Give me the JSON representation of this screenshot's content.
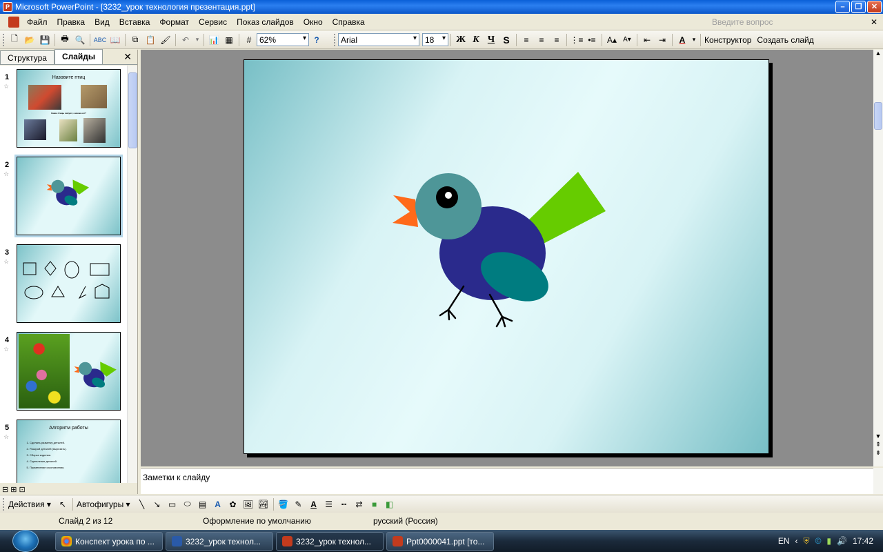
{
  "window": {
    "title": "Microsoft PowerPoint - [3232_урок технология презентация.ppt]"
  },
  "menu": {
    "items": [
      "Файл",
      "Правка",
      "Вид",
      "Вставка",
      "Формат",
      "Сервис",
      "Показ слайдов",
      "Окно",
      "Справка"
    ],
    "help_placeholder": "Введите вопрос"
  },
  "toolbar": {
    "zoom": "62%",
    "font": "Arial",
    "font_size": "18",
    "bold": "Ж",
    "italic": "К",
    "underline": "Ч",
    "shadow": "S",
    "designer": "Конструктор",
    "new_slide": "Создать слайд"
  },
  "left_pane": {
    "tabs": [
      "Структура",
      "Слайды"
    ],
    "slides": [
      {
        "num": "1",
        "title": "Назовите птиц",
        "caption": "Какие птицы зимуют, а какие нет?"
      },
      {
        "num": "2"
      },
      {
        "num": "3"
      },
      {
        "num": "4"
      },
      {
        "num": "5",
        "title": "Алгоритм работы",
        "steps": [
          "Сделать разметку деталей.",
          "Раскрой деталей (вырезать).",
          "Сборка изделия.",
          "Скрепление деталей.",
          "Применение изготовления."
        ]
      }
    ]
  },
  "notes": {
    "placeholder": "Заметки к слайду"
  },
  "drawbar": {
    "actions": "Действия",
    "autoshapes": "Автофигуры"
  },
  "status": {
    "slide": "Слайд 2 из 12",
    "design": "Оформление по умолчанию",
    "language": "русский (Россия)"
  },
  "taskbar": {
    "tasks": [
      "Конспект урока по ...",
      "3232_урок технол...",
      "3232_урок технол...",
      "Ppt0000041.ppt [то..."
    ],
    "lang": "EN",
    "time": "17:42"
  },
  "colors": {
    "bird_body": "#2a2a8c",
    "bird_head": "#4e9698",
    "bird_wing": "#007c80",
    "bird_tail": "#66cc00",
    "bird_beak": "#ff6a1a"
  }
}
